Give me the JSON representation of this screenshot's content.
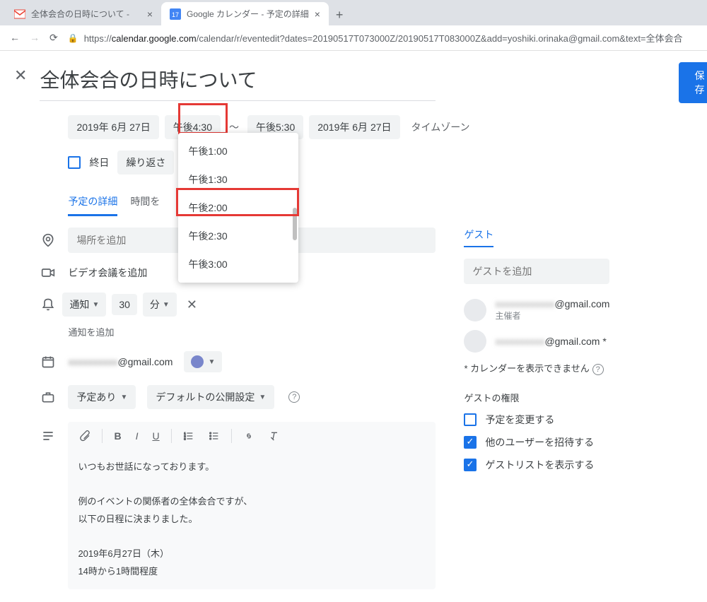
{
  "browser": {
    "tabs": [
      {
        "title": "全体会合の日時について - ",
        "favicon": "gmail"
      },
      {
        "title": "Google カレンダー - 予定の詳細",
        "favicon": "gcal",
        "active": true
      }
    ],
    "url_host": "calendar.google.com",
    "url_path": "/calendar/r/eventedit?dates=20190517T073000Z/20190517T083000Z&add=yoshiki.orinaka@gmail.com&text=全体会合"
  },
  "header": {
    "title": "全体会合の日時について",
    "save": "保存"
  },
  "datetime": {
    "start_date": "2019年 6月 27日",
    "start_time": "午後4:30",
    "end_time": "午後5:30",
    "end_date": "2019年 6月 27日",
    "timezone": "タイムゾーン",
    "allday": "終日",
    "repeat": "繰り返さ"
  },
  "time_options": [
    "午後1:00",
    "午後1:30",
    "午後2:00",
    "午後2:30",
    "午後3:00"
  ],
  "tabs": {
    "details": "予定の詳細",
    "findtime": "時間を"
  },
  "fields": {
    "location_placeholder": "場所を追加",
    "video": "ビデオ会議を追加",
    "notification": {
      "type": "通知",
      "value": "30",
      "unit": "分"
    },
    "add_notification": "通知を追加",
    "calendar_email_suffix": "@gmail.com",
    "busy": "予定あり",
    "visibility": "デフォルトの公開設定"
  },
  "description": "いつもお世話になっております。\n\n例のイベントの関係者の全体会合ですが、\n以下の日程に決まりました。\n\n2019年6月27日（木）\n14時から1時間程度",
  "guests": {
    "title": "ゲスト",
    "add_placeholder": "ゲストを追加",
    "list": [
      {
        "email_suffix": "@gmail.com",
        "sub": "主催者"
      },
      {
        "email_suffix": "@gmail.com *",
        "sub": ""
      }
    ],
    "warn": "* カレンダーを表示できません",
    "perm_title": "ゲストの権限",
    "perms": [
      {
        "checked": false,
        "label": "予定を変更する"
      },
      {
        "checked": true,
        "label": "他のユーザーを招待する"
      },
      {
        "checked": true,
        "label": "ゲストリストを表示する"
      }
    ]
  }
}
